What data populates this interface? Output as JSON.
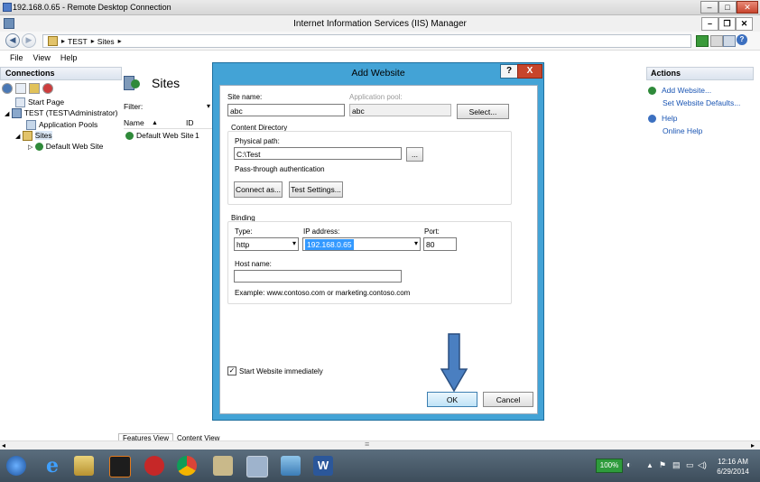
{
  "rdp": {
    "title": "192.168.0.65 - Remote Desktop Connection"
  },
  "iis": {
    "title": "Internet Information Services (IIS) Manager",
    "breadcrumb": [
      "TEST",
      "Sites"
    ],
    "menu": [
      "File",
      "View",
      "Help"
    ]
  },
  "connections": {
    "title": "Connections",
    "tree": [
      "Start Page",
      "TEST (TEST\\Administrator)",
      "Application Pools",
      "Sites",
      "Default Web Site"
    ]
  },
  "center": {
    "title": "Sites",
    "filter_label": "Filter:",
    "columns": [
      "Name",
      "ID"
    ],
    "rows": [
      {
        "name": "Default Web Site",
        "id": "1"
      }
    ],
    "bottom_tabs": [
      "Features View",
      "Content View"
    ]
  },
  "actions": {
    "title": "Actions",
    "items": [
      "Add Website...",
      "Set Website Defaults...",
      "Help",
      "Online Help"
    ]
  },
  "dialog": {
    "title": "Add Website",
    "help_glyph": "?",
    "close_glyph": "X",
    "site_name_label": "Site name:",
    "site_name_value": "abc",
    "app_pool_label": "Application pool:",
    "app_pool_value": "abc",
    "select_button": "Select...",
    "content_dir_label": "Content Directory",
    "physical_path_label": "Physical path:",
    "physical_path_value": "C:\\Test",
    "browse_button": "...",
    "passthrough_label": "Pass-through authentication",
    "connect_as_button": "Connect as...",
    "test_settings_button": "Test Settings...",
    "binding_label": "Binding",
    "type_label": "Type:",
    "type_value": "http",
    "ip_label": "IP address:",
    "ip_value": "192.168.0.65",
    "port_label": "Port:",
    "port_value": "80",
    "host_name_label": "Host name:",
    "host_name_value": "",
    "example_text": "Example: www.contoso.com or marketing.contoso.com",
    "start_immediately_label": "Start Website immediately",
    "start_immediately_checked": true,
    "ok_button": "OK",
    "cancel_button": "Cancel",
    "arrow_color": "#4a7fc1"
  },
  "taskbar": {
    "battery_text": "100%",
    "time": "12:16 AM",
    "date": "6/29/2014"
  }
}
